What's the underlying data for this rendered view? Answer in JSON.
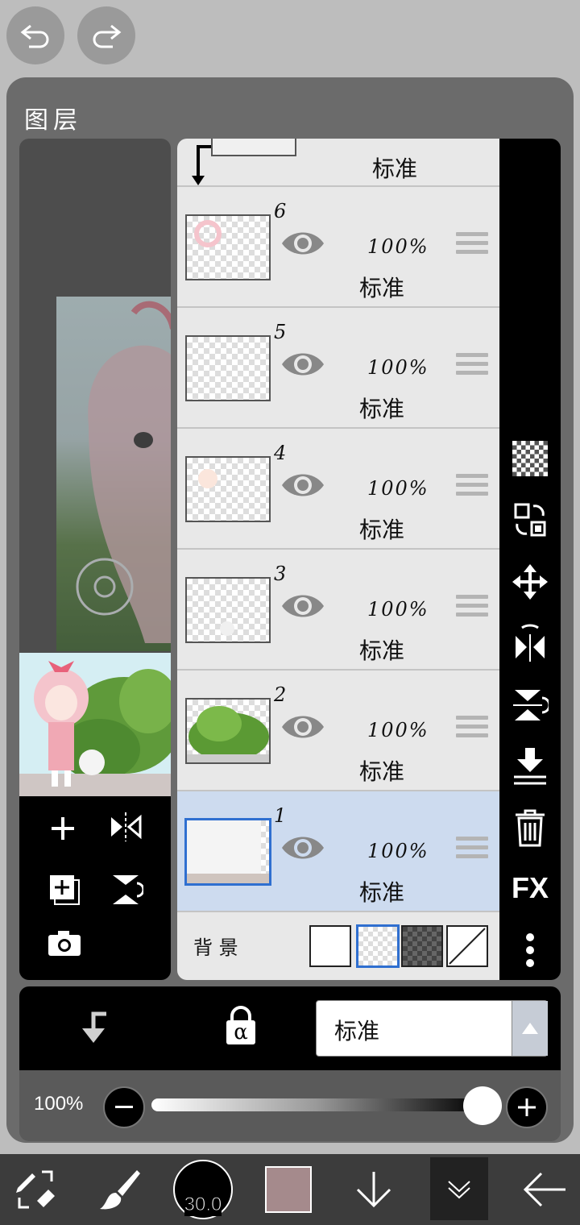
{
  "top_buttons": {
    "undo": "undo-icon",
    "redo": "redo-icon"
  },
  "panel": {
    "title": "图层"
  },
  "top_partial_layer": {
    "blend": "标准"
  },
  "layers": [
    {
      "num": "6",
      "opacity": "100%",
      "blend": "标准",
      "selected": false
    },
    {
      "num": "5",
      "opacity": "100%",
      "blend": "标准",
      "selected": false
    },
    {
      "num": "4",
      "opacity": "100%",
      "blend": "标准",
      "selected": false
    },
    {
      "num": "3",
      "opacity": "100%",
      "blend": "标准",
      "selected": false
    },
    {
      "num": "2",
      "opacity": "100%",
      "blend": "标准",
      "selected": false
    },
    {
      "num": "1",
      "opacity": "100%",
      "blend": "标准",
      "selected": true
    }
  ],
  "background_row": {
    "label": "背 景",
    "selected_swatch": "transparent"
  },
  "right_tools": [
    "checker-icon",
    "swap-icon",
    "move-icon",
    "flip-horizontal-icon",
    "flip-vertical-icon",
    "merge-down-icon",
    "trash-icon",
    "FX",
    "more-icon"
  ],
  "canvas_tools": [
    "add-layer-icon",
    "flip-layer-icon",
    "add-copy-icon",
    "rotate-icon",
    "camera-icon"
  ],
  "blend_bar": {
    "mode": "标准",
    "clip_icon": "clip-arrow-icon",
    "alpha_lock": "α"
  },
  "opacity_bar": {
    "value_label": "100%",
    "value": 1.0
  },
  "bottom_bar": {
    "brush_size": "30.0",
    "color": "#a58a8c"
  },
  "colors": {
    "panel": "#6b6b6b",
    "selected_layer": "#cddbef",
    "accent": "#2f6fd0"
  }
}
